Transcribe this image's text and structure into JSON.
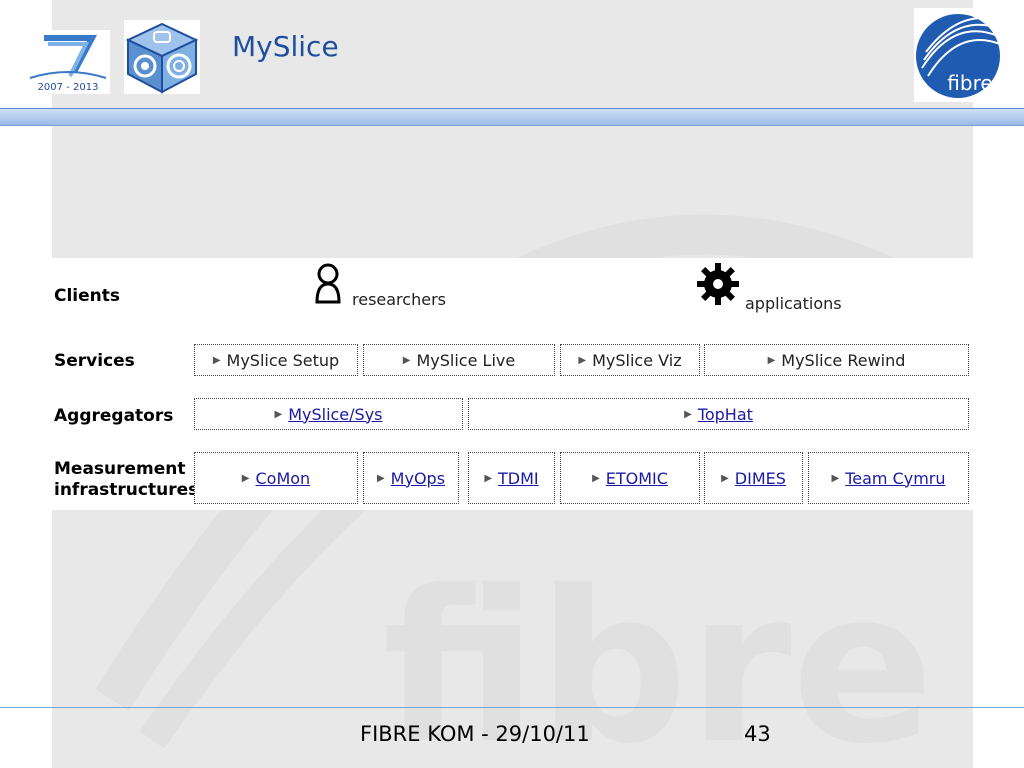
{
  "slide": {
    "title": "MySlice",
    "footer_text": "FIBRE KOM - 29/10/11",
    "page_number": "43"
  },
  "logos": {
    "fp7_years": "2007 - 2013",
    "fibre_text": "fibre"
  },
  "watermark_text": "fibre",
  "clients": {
    "label": "Clients",
    "researchers": "researchers",
    "applications": "applications"
  },
  "services": {
    "label": "Services",
    "items": [
      "MySlice Setup",
      "MySlice Live",
      "MySlice Viz",
      "MySlice Rewind"
    ]
  },
  "aggregators": {
    "label": "Aggregators",
    "items": [
      "MySlice/Sys",
      "TopHat"
    ]
  },
  "measurement": {
    "label_line1": "Measurement",
    "label_line2": "infrastructures",
    "items": [
      "CoMon",
      "MyOps",
      "TDMI",
      "ETOMIC",
      "DIMES",
      "Team Cymru"
    ]
  },
  "colors": {
    "title": "#1f4e9c",
    "link": "#1a1aa6",
    "band": "#9dbbe6"
  }
}
